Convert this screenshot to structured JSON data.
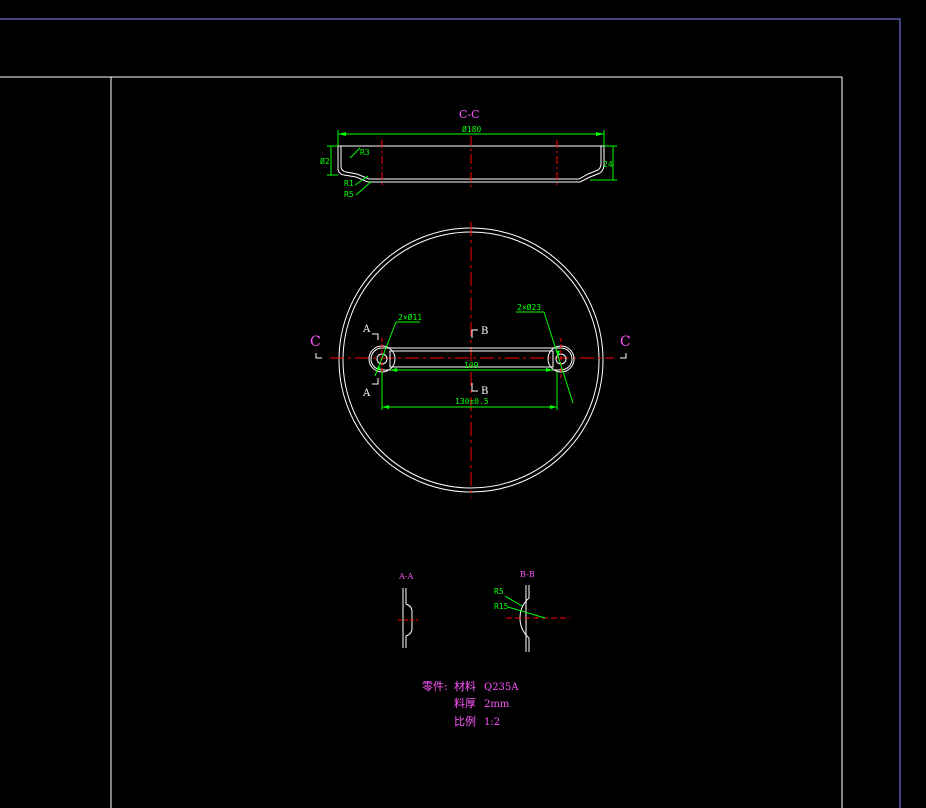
{
  "colors": {
    "background": "#000000",
    "outline": "#ffffff",
    "frame_blue": "#8888ff",
    "dimension": "#00ff00",
    "centerline": "#ff0000",
    "annotation": "#ff55ff"
  },
  "section_cc": {
    "title": "C-C",
    "dim_diameter": "Ø180",
    "dim_r3": "R3",
    "dim_r1": "R1",
    "dim_r5": "R5",
    "dim_height_left": "Ø2",
    "dim_height_right": "24"
  },
  "plan_view": {
    "cut_c_left": "C",
    "cut_c_right": "C",
    "cut_a_top": "A",
    "cut_a_bottom": "A",
    "cut_b_top": "B",
    "cut_b_bottom": "B",
    "hole_note_left": "2×Ø11",
    "hole_note_right": "2×Ø23",
    "dim_inner": "109",
    "dim_outer": "130±0.5"
  },
  "section_aa": {
    "title": "A-A"
  },
  "section_bb": {
    "title": "B-B",
    "r5": "R5",
    "r15": "R15"
  },
  "notes": {
    "part_label": "零件:",
    "material_label": "材料",
    "material_value": "Q235A",
    "thickness_label": "料厚",
    "thickness_value": "2mm",
    "scale_label": "比例",
    "scale_value": "1:2"
  }
}
